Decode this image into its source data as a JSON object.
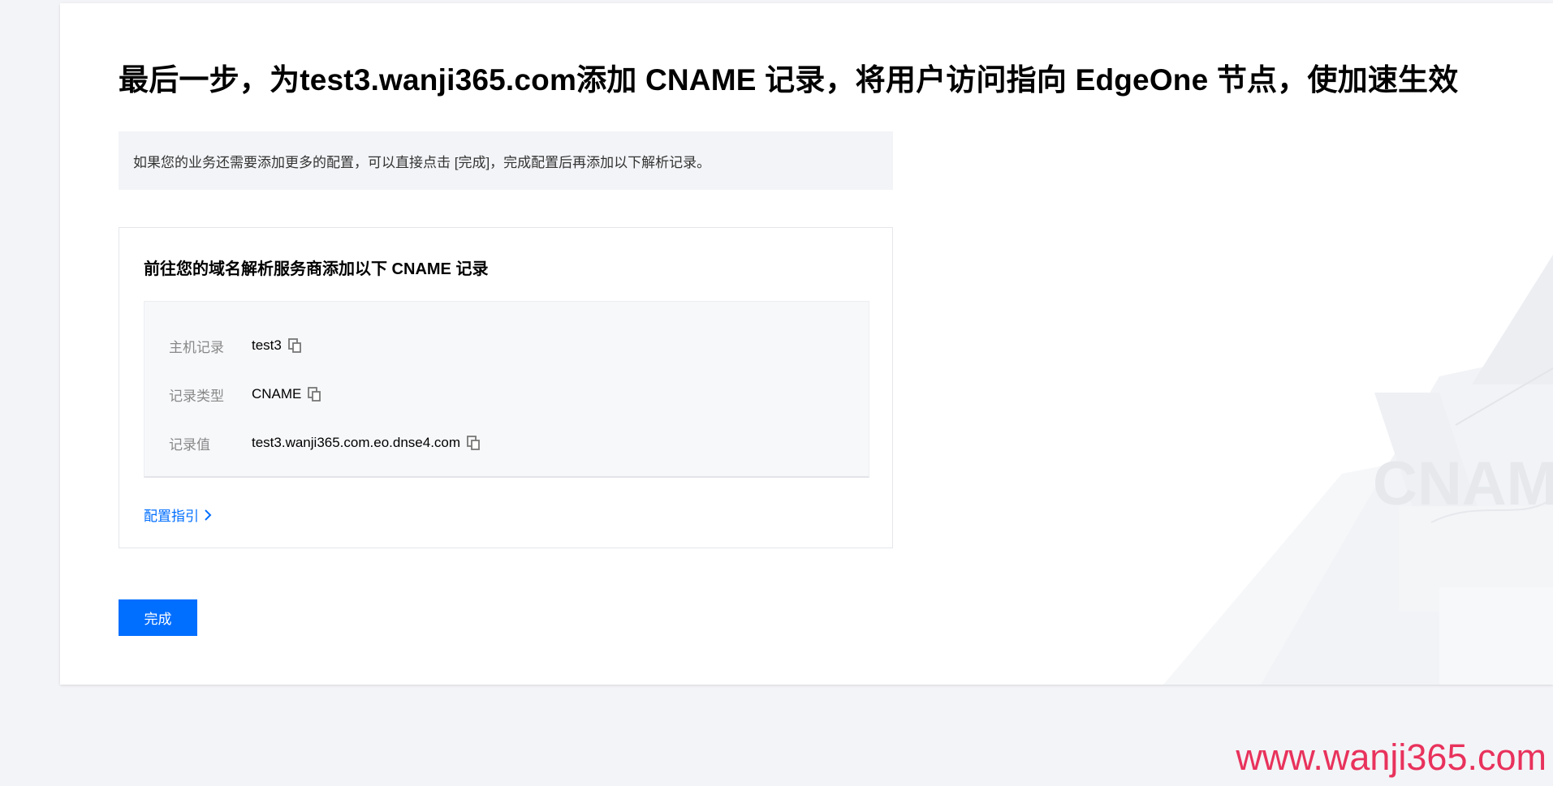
{
  "header": {
    "title": "最后一步，为test3.wanji365.com添加 CNAME 记录，将用户访问指向 EdgeOne 节点，使加速生效"
  },
  "notice": {
    "text": "如果您的业务还需要添加更多的配置，可以直接点击 [完成]，完成配置后再添加以下解析记录。"
  },
  "record_section": {
    "title": "前往您的域名解析服务商添加以下 CNAME 记录",
    "rows": [
      {
        "label": "主机记录",
        "value": "test3"
      },
      {
        "label": "记录类型",
        "value": "CNAME"
      },
      {
        "label": "记录值",
        "value": "test3.wanji365.com.eo.dnse4.com"
      }
    ],
    "guide_link": "配置指引"
  },
  "actions": {
    "done_label": "完成"
  },
  "decoration": {
    "cname_text": "CNAM"
  },
  "watermark": {
    "text": "www.wanji365.com"
  },
  "colors": {
    "accent": "#006eff",
    "watermark": "#e8325c",
    "background": "#f3f4f7"
  }
}
